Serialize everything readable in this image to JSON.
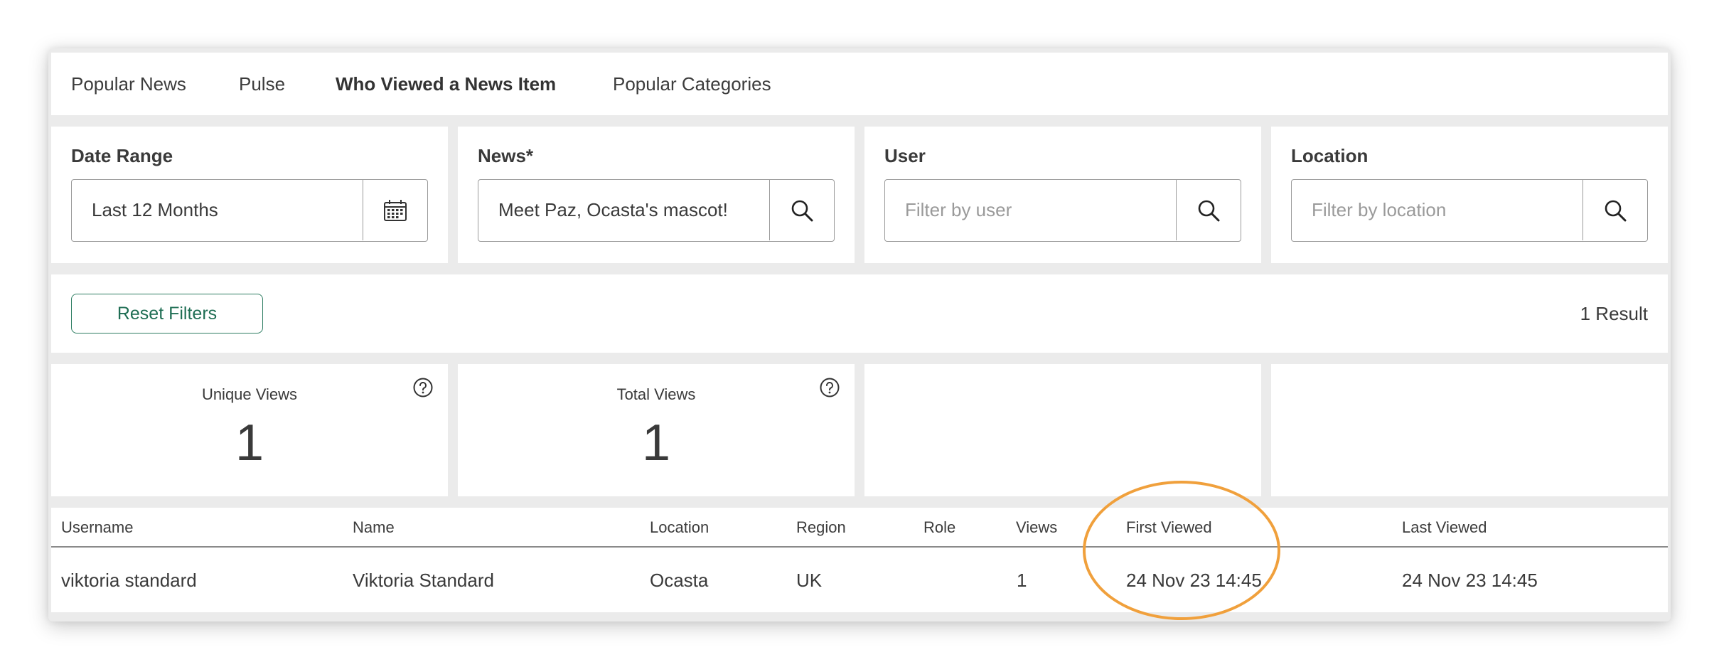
{
  "tabs": [
    {
      "label": "Popular News",
      "active": false
    },
    {
      "label": "Pulse",
      "active": false
    },
    {
      "label": "Who Viewed a News Item",
      "active": true
    },
    {
      "label": "Popular Categories",
      "active": false
    }
  ],
  "filters": {
    "date_range": {
      "label": "Date Range",
      "value": "Last 12 Months",
      "icon": "calendar-icon"
    },
    "news": {
      "label": "News*",
      "value": "Meet Paz, Ocasta's mascot!",
      "icon": "search-icon"
    },
    "user": {
      "label": "User",
      "placeholder": "Filter by user",
      "icon": "search-icon"
    },
    "location": {
      "label": "Location",
      "placeholder": "Filter by location",
      "icon": "search-icon"
    }
  },
  "reset_label": "Reset Filters",
  "result_count": "1 Result",
  "stats": {
    "unique_views": {
      "label": "Unique Views",
      "value": "1"
    },
    "total_views": {
      "label": "Total Views",
      "value": "1"
    }
  },
  "table": {
    "headers": [
      "Username",
      "Name",
      "Location",
      "Region",
      "Role",
      "Views",
      "First Viewed",
      "Last Viewed"
    ],
    "rows": [
      [
        "viktoria standard",
        "Viktoria Standard",
        "Ocasta",
        "UK",
        "",
        "1",
        "24 Nov 23 14:45",
        "24 Nov 23 14:45"
      ]
    ]
  },
  "colors": {
    "accent": "#1f6e54",
    "highlight": "#f0a03c",
    "background": "#ebebeb"
  }
}
